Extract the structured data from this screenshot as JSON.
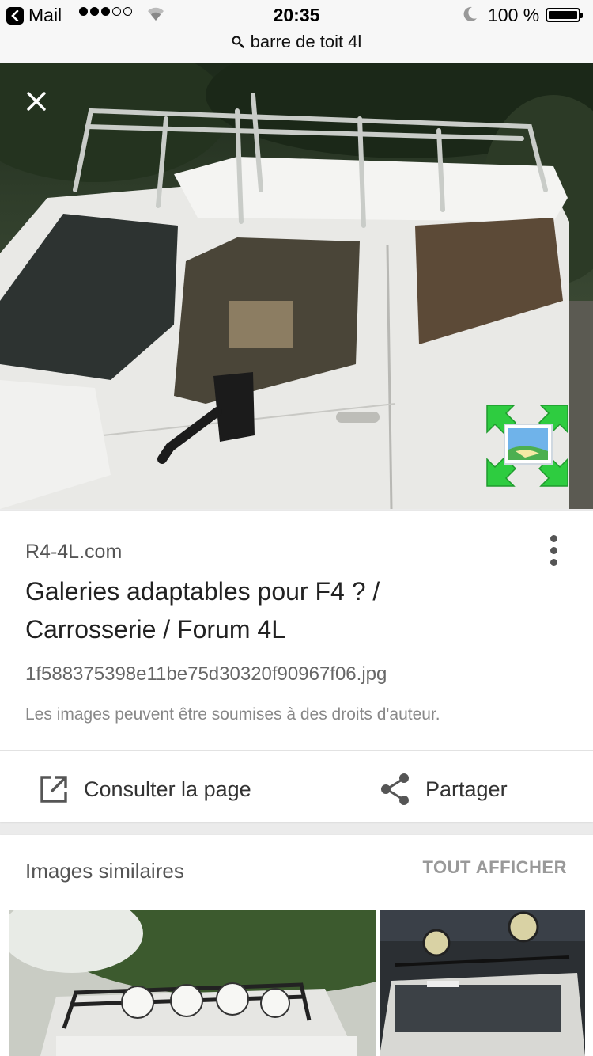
{
  "status_bar": {
    "back_app": "Mail",
    "signal_filled": 3,
    "signal_total": 5,
    "time": "20:35",
    "battery": "100 %"
  },
  "url_bar": {
    "query": "barre de toit 4l"
  },
  "result": {
    "source": "R4-4L.com",
    "title": "Galeries adaptables pour F4 ? / Carrosserie / Forum 4L",
    "filename": "1f588375398e11be75d30320f90967f06.jpg",
    "copyright": "Les images peuvent être soumises à des droits d'auteur.",
    "visit_label": "Consulter la page",
    "share_label": "Partager"
  },
  "similar": {
    "title": "Images similaires",
    "view_all": "TOUT AFFICHER"
  },
  "colors": {
    "accent_green": "#2ecc40",
    "text_primary": "#222222",
    "text_secondary": "#666666"
  }
}
